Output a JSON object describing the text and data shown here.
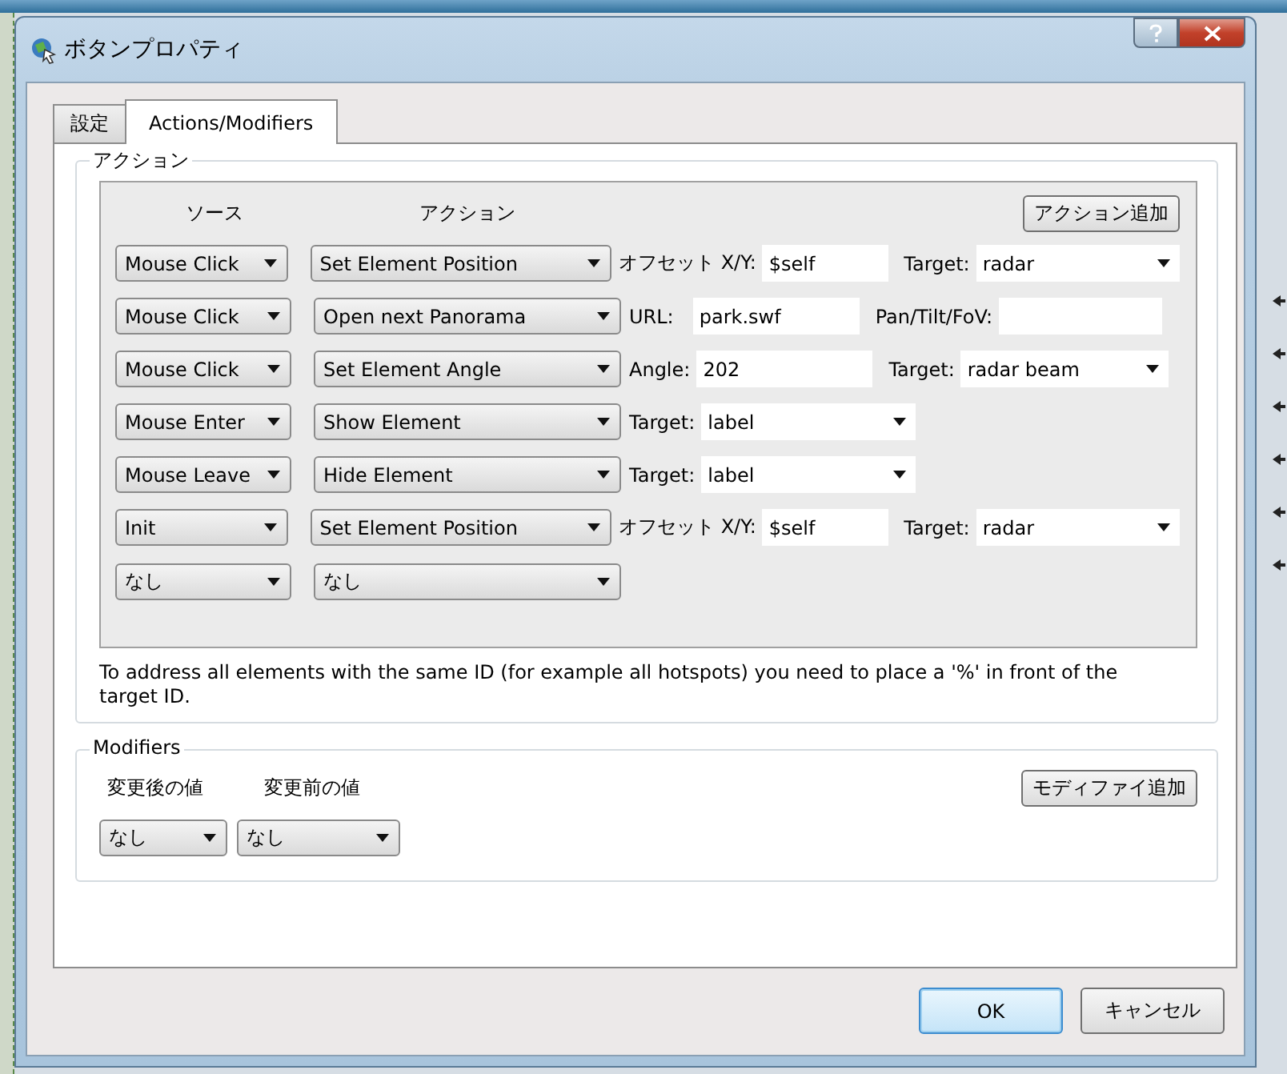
{
  "window": {
    "title": "ボタンプロパティ"
  },
  "tabs": [
    {
      "label": "設定",
      "selected": false
    },
    {
      "label": "Actions/Modifiers",
      "selected": true
    }
  ],
  "actions": {
    "title": "アクション",
    "source_header": "ソース",
    "action_header": "アクション",
    "add_button": "アクション追加",
    "rows": [
      {
        "source": "Mouse Click",
        "action": "Set Element Position",
        "kind": "offset",
        "params": [
          {
            "label": "オフセット X/Y:",
            "value": "$self"
          },
          {
            "label": "Target:",
            "value": "radar"
          }
        ]
      },
      {
        "source": "Mouse Click",
        "action": "Open next Panorama",
        "kind": "url",
        "params": [
          {
            "label": "URL:",
            "value": "park.swf"
          },
          {
            "label": "Pan/Tilt/FoV:"
          }
        ]
      },
      {
        "source": "Mouse Click",
        "action": "Set Element Angle",
        "kind": "angle",
        "params": [
          {
            "label": "Angle:",
            "value": "202"
          },
          {
            "label": "Target:",
            "value": "radar beam"
          }
        ]
      },
      {
        "source": "Mouse Enter",
        "action": "Show Element",
        "kind": "target",
        "params": [
          {
            "label": "Target:",
            "value": "label"
          }
        ]
      },
      {
        "source": "Mouse Leave",
        "action": "Hide Element",
        "kind": "target",
        "params": [
          {
            "label": "Target:",
            "value": "label"
          }
        ]
      },
      {
        "source": "Init",
        "action": "Set Element Position",
        "kind": "offset",
        "params": [
          {
            "label": "オフセット X/Y:",
            "value": "$self"
          },
          {
            "label": "Target:",
            "value": "radar"
          }
        ]
      },
      {
        "source": "なし",
        "action": "なし",
        "kind": "empty",
        "params": []
      }
    ],
    "note": "To address all elements with the same ID (for example all hotspots) you need to place a '%' in front of the target ID."
  },
  "modifiers": {
    "title": "Modifiers",
    "after_header": "変更後の値",
    "before_header": "変更前の値",
    "add_button": "モディファイ追加",
    "after_value": "なし",
    "before_value": "なし"
  },
  "buttons": [
    {
      "label": "OK",
      "kind": "default"
    },
    {
      "label": "キャンセル",
      "kind": "normal"
    }
  ]
}
